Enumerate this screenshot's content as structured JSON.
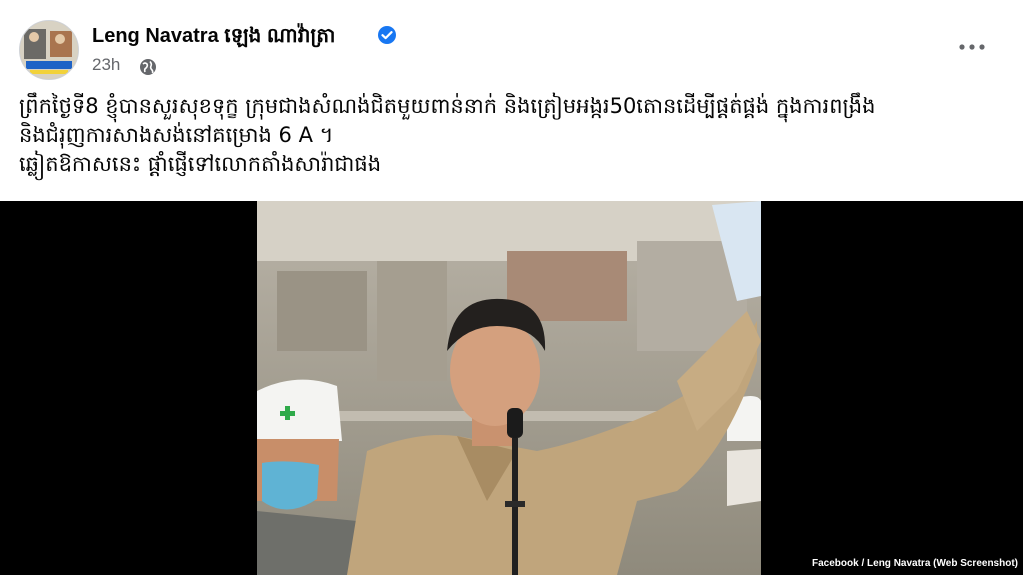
{
  "post": {
    "author": "Leng Navatra ឡេង ណាវ៉ាត្រា",
    "time": "23h",
    "audience_icon": "globe-icon",
    "verified_icon": "verified-badge-icon",
    "more_icon": "more-options-icon",
    "text_lines": [
      "ព្រឹកថ្ងៃទី8 ខ្ញុំបានសួរសុខទុក្ខ ក្រុមជាងសំណង់ជិតមួយពាន់នាក់ និងត្រៀមអង្ករ50តោនដើម្បីផ្តត់ផ្គង់  ក្នុងការពង្រឹង",
      "និងជំរុញការសាងសង់នៅគម្រោង 6 A ។",
      " ឆ្លៀតឱកាសនេះ ផ្តាំផ្ញើទៅលោកតាំងសារ៉ាជាផង"
    ]
  },
  "media": {
    "caption": "Facebook / Leng Navatra (Web Screenshot)"
  },
  "colors": {
    "verified_blue": "#1877f2",
    "secondary_text": "#65676b",
    "media_background": "#000000"
  }
}
